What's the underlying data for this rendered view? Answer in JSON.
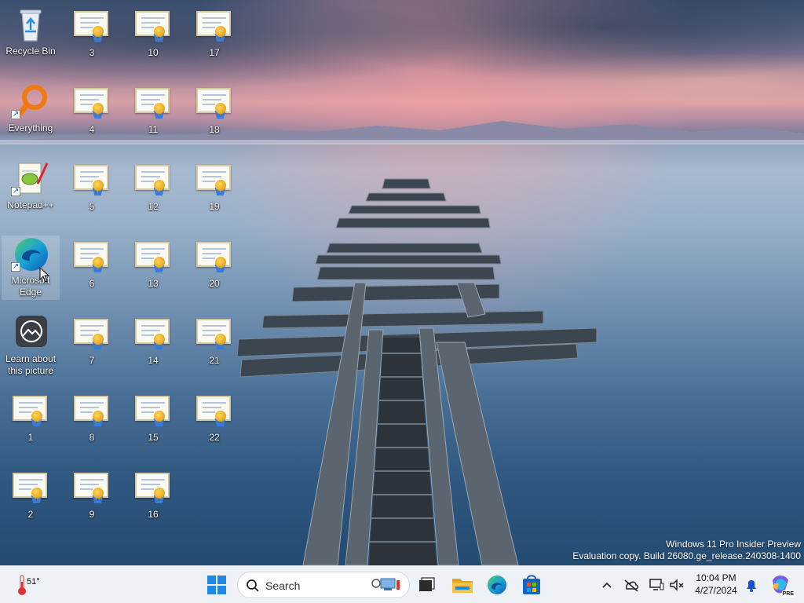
{
  "desktop": {
    "icons": [
      {
        "label": "Recycle Bin",
        "type": "recycle"
      },
      {
        "label": "Everything",
        "type": "everything"
      },
      {
        "label": "Notepad++",
        "type": "notepad"
      },
      {
        "label": "Microsoft Edge",
        "type": "edge"
      },
      {
        "label": "Learn about this picture",
        "type": "learn"
      },
      {
        "label": "1",
        "type": "cert"
      },
      {
        "label": "2",
        "type": "cert"
      },
      {
        "label": "3",
        "type": "cert"
      },
      {
        "label": "4",
        "type": "cert"
      },
      {
        "label": "5",
        "type": "cert"
      },
      {
        "label": "6",
        "type": "cert"
      },
      {
        "label": "7",
        "type": "cert"
      },
      {
        "label": "8",
        "type": "cert"
      },
      {
        "label": "9",
        "type": "cert"
      },
      {
        "label": "10",
        "type": "cert"
      },
      {
        "label": "11",
        "type": "cert"
      },
      {
        "label": "12",
        "type": "cert"
      },
      {
        "label": "13",
        "type": "cert"
      },
      {
        "label": "14",
        "type": "cert"
      },
      {
        "label": "15",
        "type": "cert"
      },
      {
        "label": "16",
        "type": "cert"
      },
      {
        "label": "17",
        "type": "cert"
      },
      {
        "label": "18",
        "type": "cert"
      },
      {
        "label": "19",
        "type": "cert"
      },
      {
        "label": "20",
        "type": "cert"
      },
      {
        "label": "21",
        "type": "cert"
      },
      {
        "label": "22",
        "type": "cert"
      }
    ],
    "watermark": {
      "line1": "Windows 11 Pro Insider Preview",
      "line2": "Evaluation copy. Build 26080.ge_release.240308-1400"
    }
  },
  "taskbar": {
    "weather": {
      "temp": "51°"
    },
    "search": {
      "placeholder": "Search"
    },
    "clock": {
      "time": "10:04 PM",
      "date": "4/27/2024"
    },
    "copilot_badge": "PRE"
  },
  "colors": {
    "taskbar_bg": "#eef1f6",
    "start_blue": "#1e88e5",
    "explorer_yellow": "#f6c142",
    "edge_blue": "#0b7bd4",
    "edge_green": "#4fc96b",
    "store_blue": "#1565c0"
  }
}
